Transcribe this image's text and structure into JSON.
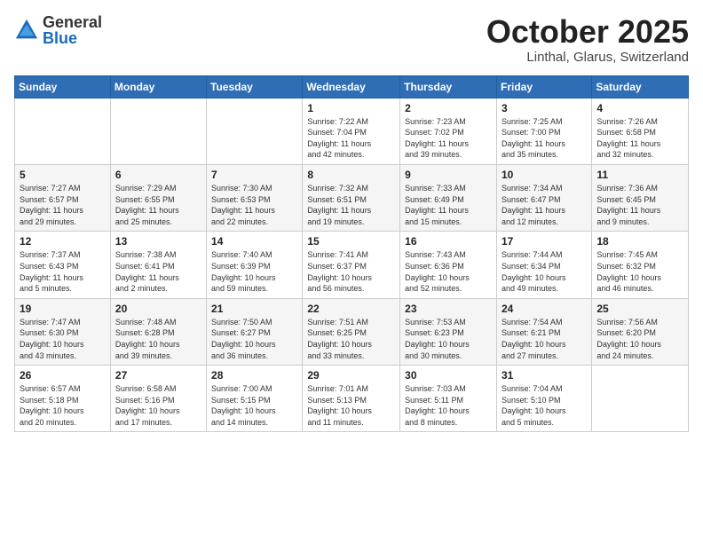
{
  "header": {
    "logo_general": "General",
    "logo_blue": "Blue",
    "month": "October 2025",
    "location": "Linthal, Glarus, Switzerland"
  },
  "days_of_week": [
    "Sunday",
    "Monday",
    "Tuesday",
    "Wednesday",
    "Thursday",
    "Friday",
    "Saturday"
  ],
  "weeks": [
    [
      {
        "day": "",
        "info": ""
      },
      {
        "day": "",
        "info": ""
      },
      {
        "day": "",
        "info": ""
      },
      {
        "day": "1",
        "info": "Sunrise: 7:22 AM\nSunset: 7:04 PM\nDaylight: 11 hours\nand 42 minutes."
      },
      {
        "day": "2",
        "info": "Sunrise: 7:23 AM\nSunset: 7:02 PM\nDaylight: 11 hours\nand 39 minutes."
      },
      {
        "day": "3",
        "info": "Sunrise: 7:25 AM\nSunset: 7:00 PM\nDaylight: 11 hours\nand 35 minutes."
      },
      {
        "day": "4",
        "info": "Sunrise: 7:26 AM\nSunset: 6:58 PM\nDaylight: 11 hours\nand 32 minutes."
      }
    ],
    [
      {
        "day": "5",
        "info": "Sunrise: 7:27 AM\nSunset: 6:57 PM\nDaylight: 11 hours\nand 29 minutes."
      },
      {
        "day": "6",
        "info": "Sunrise: 7:29 AM\nSunset: 6:55 PM\nDaylight: 11 hours\nand 25 minutes."
      },
      {
        "day": "7",
        "info": "Sunrise: 7:30 AM\nSunset: 6:53 PM\nDaylight: 11 hours\nand 22 minutes."
      },
      {
        "day": "8",
        "info": "Sunrise: 7:32 AM\nSunset: 6:51 PM\nDaylight: 11 hours\nand 19 minutes."
      },
      {
        "day": "9",
        "info": "Sunrise: 7:33 AM\nSunset: 6:49 PM\nDaylight: 11 hours\nand 15 minutes."
      },
      {
        "day": "10",
        "info": "Sunrise: 7:34 AM\nSunset: 6:47 PM\nDaylight: 11 hours\nand 12 minutes."
      },
      {
        "day": "11",
        "info": "Sunrise: 7:36 AM\nSunset: 6:45 PM\nDaylight: 11 hours\nand 9 minutes."
      }
    ],
    [
      {
        "day": "12",
        "info": "Sunrise: 7:37 AM\nSunset: 6:43 PM\nDaylight: 11 hours\nand 5 minutes."
      },
      {
        "day": "13",
        "info": "Sunrise: 7:38 AM\nSunset: 6:41 PM\nDaylight: 11 hours\nand 2 minutes."
      },
      {
        "day": "14",
        "info": "Sunrise: 7:40 AM\nSunset: 6:39 PM\nDaylight: 10 hours\nand 59 minutes."
      },
      {
        "day": "15",
        "info": "Sunrise: 7:41 AM\nSunset: 6:37 PM\nDaylight: 10 hours\nand 56 minutes."
      },
      {
        "day": "16",
        "info": "Sunrise: 7:43 AM\nSunset: 6:36 PM\nDaylight: 10 hours\nand 52 minutes."
      },
      {
        "day": "17",
        "info": "Sunrise: 7:44 AM\nSunset: 6:34 PM\nDaylight: 10 hours\nand 49 minutes."
      },
      {
        "day": "18",
        "info": "Sunrise: 7:45 AM\nSunset: 6:32 PM\nDaylight: 10 hours\nand 46 minutes."
      }
    ],
    [
      {
        "day": "19",
        "info": "Sunrise: 7:47 AM\nSunset: 6:30 PM\nDaylight: 10 hours\nand 43 minutes."
      },
      {
        "day": "20",
        "info": "Sunrise: 7:48 AM\nSunset: 6:28 PM\nDaylight: 10 hours\nand 39 minutes."
      },
      {
        "day": "21",
        "info": "Sunrise: 7:50 AM\nSunset: 6:27 PM\nDaylight: 10 hours\nand 36 minutes."
      },
      {
        "day": "22",
        "info": "Sunrise: 7:51 AM\nSunset: 6:25 PM\nDaylight: 10 hours\nand 33 minutes."
      },
      {
        "day": "23",
        "info": "Sunrise: 7:53 AM\nSunset: 6:23 PM\nDaylight: 10 hours\nand 30 minutes."
      },
      {
        "day": "24",
        "info": "Sunrise: 7:54 AM\nSunset: 6:21 PM\nDaylight: 10 hours\nand 27 minutes."
      },
      {
        "day": "25",
        "info": "Sunrise: 7:56 AM\nSunset: 6:20 PM\nDaylight: 10 hours\nand 24 minutes."
      }
    ],
    [
      {
        "day": "26",
        "info": "Sunrise: 6:57 AM\nSunset: 5:18 PM\nDaylight: 10 hours\nand 20 minutes."
      },
      {
        "day": "27",
        "info": "Sunrise: 6:58 AM\nSunset: 5:16 PM\nDaylight: 10 hours\nand 17 minutes."
      },
      {
        "day": "28",
        "info": "Sunrise: 7:00 AM\nSunset: 5:15 PM\nDaylight: 10 hours\nand 14 minutes."
      },
      {
        "day": "29",
        "info": "Sunrise: 7:01 AM\nSunset: 5:13 PM\nDaylight: 10 hours\nand 11 minutes."
      },
      {
        "day": "30",
        "info": "Sunrise: 7:03 AM\nSunset: 5:11 PM\nDaylight: 10 hours\nand 8 minutes."
      },
      {
        "day": "31",
        "info": "Sunrise: 7:04 AM\nSunset: 5:10 PM\nDaylight: 10 hours\nand 5 minutes."
      },
      {
        "day": "",
        "info": ""
      }
    ]
  ]
}
